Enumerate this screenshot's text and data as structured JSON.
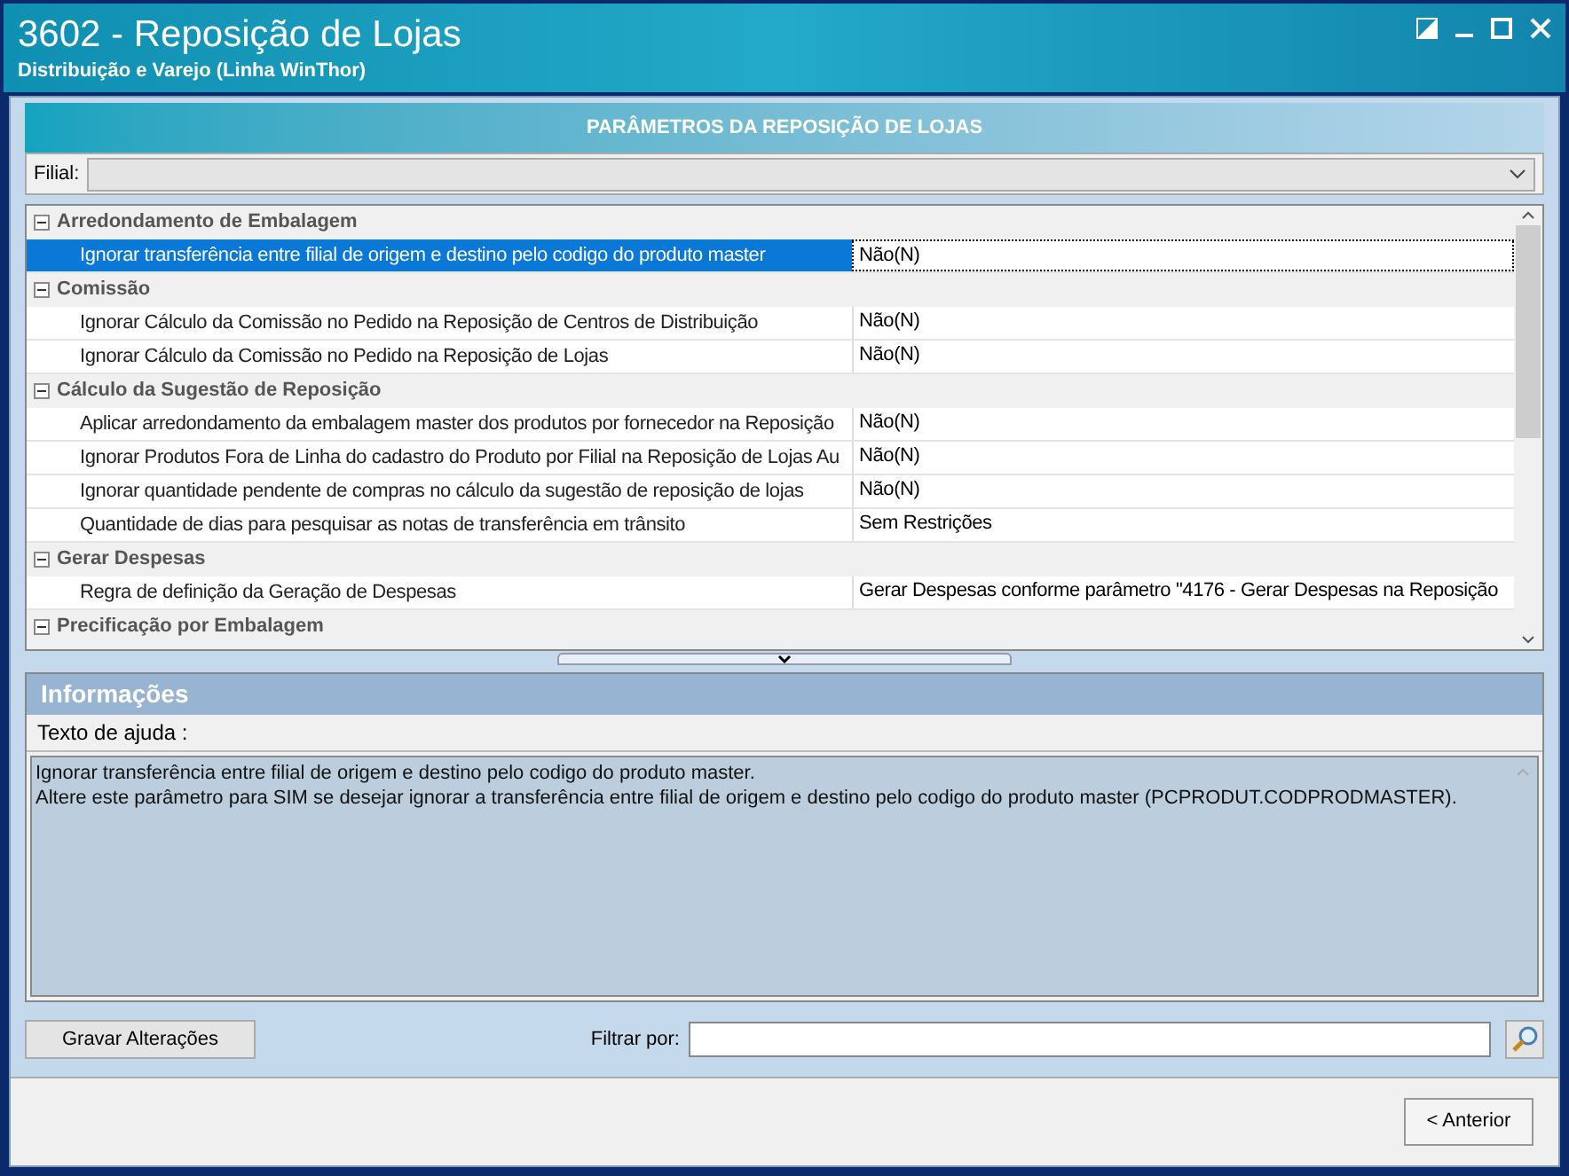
{
  "window": {
    "title": "3602 - Reposição de Lojas",
    "subtitle": "Distribuição e Varejo (Linha WinThor)"
  },
  "panel_title": "PARÂMETROS DA REPOSIÇÃO DE LOJAS",
  "filial": {
    "label": "Filial:"
  },
  "groups": [
    {
      "name": "Arredondamento de Embalagem",
      "expanded": true,
      "rows": [
        {
          "label": "Ignorar transferência entre filial de origem e destino pelo codigo do produto master",
          "value": "Não(N)",
          "selected": true
        }
      ]
    },
    {
      "name": "Comissão",
      "expanded": true,
      "rows": [
        {
          "label": "Ignorar Cálculo da Comissão no Pedido na Reposição de Centros de Distribuição",
          "value": "Não(N)",
          "selected": false
        },
        {
          "label": "Ignorar Cálculo da Comissão no Pedido na Reposição de Lojas",
          "value": "Não(N)",
          "selected": false
        }
      ]
    },
    {
      "name": "Cálculo da Sugestão de Reposição",
      "expanded": true,
      "rows": [
        {
          "label": "Aplicar arredondamento da embalagem master dos produtos por fornecedor na Reposição",
          "value": "Não(N)",
          "selected": false
        },
        {
          "label": "Ignorar Produtos Fora de Linha do cadastro do Produto por Filial na Reposição de Lojas Au",
          "value": "Não(N)",
          "selected": false
        },
        {
          "label": "Ignorar quantidade pendente de compras no cálculo da sugestão de reposição de lojas",
          "value": "Não(N)",
          "selected": false
        },
        {
          "label": "Quantidade de dias para pesquisar as notas de transferência em trânsito",
          "value": "Sem Restrições",
          "selected": false
        }
      ]
    },
    {
      "name": "Gerar Despesas",
      "expanded": true,
      "rows": [
        {
          "label": "Regra de definição da Geração de Despesas",
          "value": "Gerar Despesas conforme parâmetro \"4176 - Gerar Despesas na Reposição",
          "selected": false
        }
      ]
    },
    {
      "name": "Precificação por Embalagem",
      "expanded": true
    }
  ],
  "info": {
    "title": "Informações",
    "help_label": "Texto de ajuda :",
    "help_lines": [
      "Ignorar transferência entre filial de origem e destino pelo codigo do produto master.",
      "Altere este parâmetro para SIM se desejar ignorar a transferência entre filial de origem e destino pelo codigo do produto master (PCPRODUT.CODPRODMASTER)."
    ]
  },
  "save_button": "Gravar Alterações",
  "filter": {
    "label": "Filtrar por:"
  },
  "back_button": "< Anterior"
}
